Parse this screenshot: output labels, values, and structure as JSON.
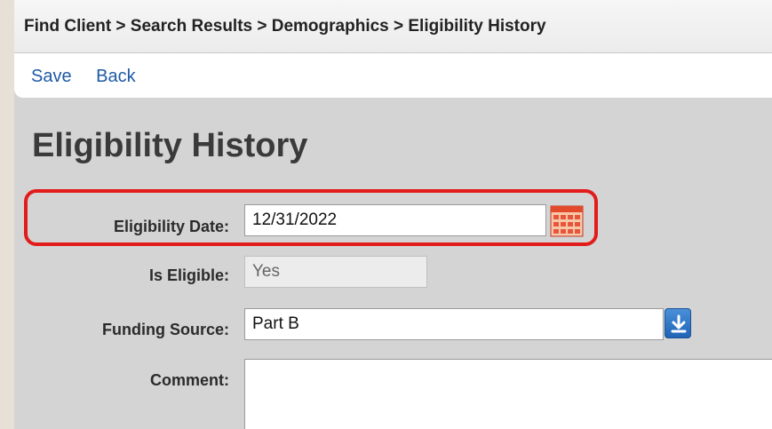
{
  "breadcrumb": "Find Client > Search Results > Demographics > Eligibility History",
  "toolbar": {
    "save_label": "Save",
    "back_label": "Back"
  },
  "page_title": "Eligibility History",
  "form": {
    "eligibility_date": {
      "label": "Eligibility Date:",
      "value": "12/31/2022"
    },
    "is_eligible": {
      "label": "Is Eligible:",
      "value": "Yes"
    },
    "funding_source": {
      "label": "Funding Source:",
      "value": "Part B"
    },
    "comment": {
      "label": "Comment:",
      "value": ""
    }
  },
  "icons": {
    "calendar": "calendar-icon",
    "dropdown": "download-arrow-icon"
  },
  "colors": {
    "link": "#1f5aa6",
    "highlight": "#e21b1b",
    "dropdown_button": "#1f64b6",
    "panel_bg": "#d4d4d4"
  }
}
